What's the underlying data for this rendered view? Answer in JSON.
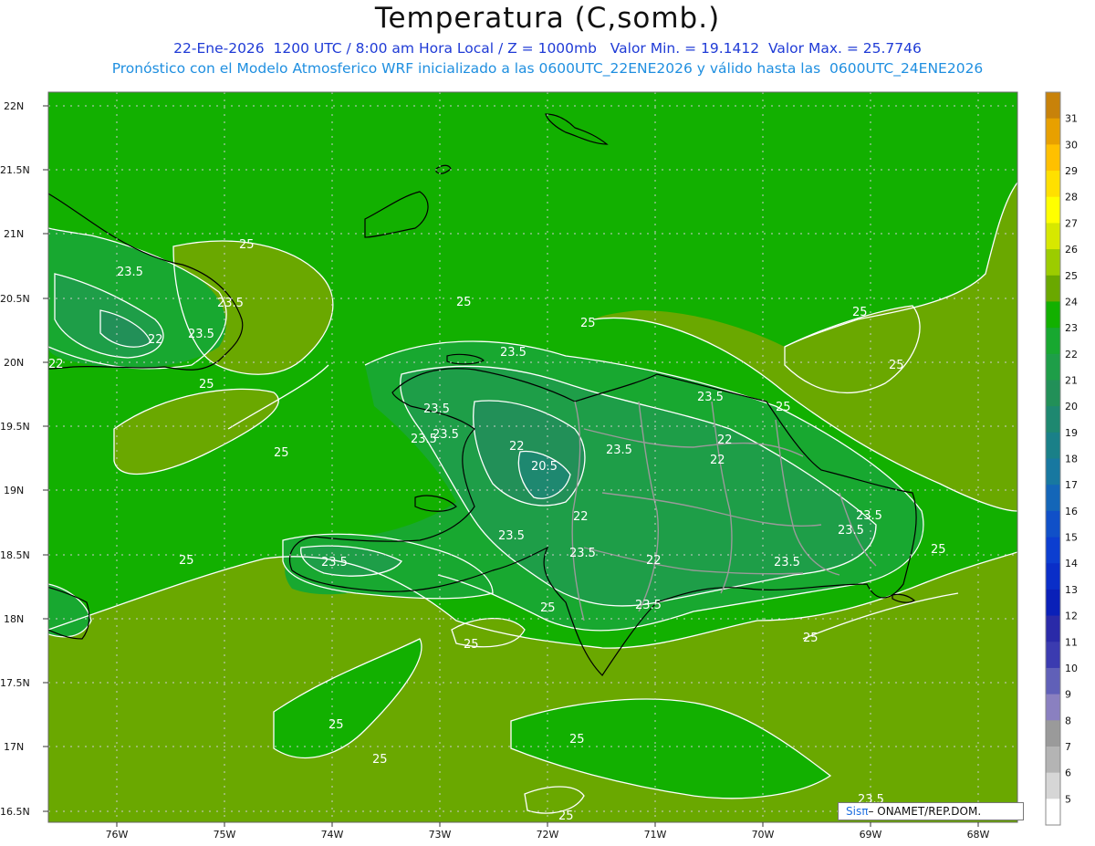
{
  "header": {
    "title": "Temperatura (C,somb.)",
    "line1": "22-Ene-2026  1200 UTC / 8:00 am Hora Local / Z = 1000mb   Valor Min. = 19.1412  Valor Max. = 25.7746",
    "line2": "Pronóstico con el Modelo Atmosferico WRF inicializado a las 0600UTC_22ENE2026 y válido hasta las  0600UTC_24ENE2026"
  },
  "axes": {
    "lat_labels": [
      "22N",
      "21.5N",
      "21N",
      "20.5N",
      "20N",
      "19.5N",
      "19N",
      "18.5N",
      "18N",
      "17.5N",
      "17N",
      "16.5N"
    ],
    "lon_labels": [
      "76W",
      "75W",
      "74W",
      "73W",
      "72W",
      "71W",
      "70W",
      "69W",
      "68W"
    ]
  },
  "colorbar": {
    "labels": [
      "31",
      "30",
      "29",
      "28",
      "27",
      "26",
      "25",
      "24",
      "23",
      "22",
      "21",
      "20",
      "19",
      "18",
      "17",
      "16",
      "15",
      "14",
      "13",
      "12",
      "11",
      "10",
      "9",
      "8",
      "7",
      "6",
      "5"
    ],
    "colors": [
      "#c8820a",
      "#e8a000",
      "#ffc000",
      "#ffe000",
      "#ffff00",
      "#d7e800",
      "#9ccc00",
      "#6aa800",
      "#12b000",
      "#18a830",
      "#1e9e48",
      "#229058",
      "#1e8870",
      "#1a8088",
      "#1878a0",
      "#1466b8",
      "#1050c8",
      "#0c3ed0",
      "#0a2ec8",
      "#0a20b8",
      "#2a2aa8",
      "#3b3bb0",
      "#6060b8",
      "#8a80c0",
      "#9a9a9a",
      "#b4b4b4",
      "#d6d6d6",
      "#ffffff"
    ]
  },
  "contour_labels": [
    {
      "text": "25"
    },
    {
      "text": "23.5"
    },
    {
      "text": "23.5"
    },
    {
      "text": "22"
    },
    {
      "text": "23.5"
    },
    {
      "text": "22"
    },
    {
      "text": "25"
    },
    {
      "text": "25"
    },
    {
      "text": "25"
    },
    {
      "text": "25"
    },
    {
      "text": "25"
    },
    {
      "text": "25"
    },
    {
      "text": "23.5"
    },
    {
      "text": "23.5"
    },
    {
      "text": "23.5"
    },
    {
      "text": "22"
    },
    {
      "text": "20.5"
    },
    {
      "text": "22"
    },
    {
      "text": "23.5"
    },
    {
      "text": "23.5"
    },
    {
      "text": "22"
    },
    {
      "text": "22"
    },
    {
      "text": "23.5"
    },
    {
      "text": "23.5"
    },
    {
      "text": "23.5"
    },
    {
      "text": "25"
    },
    {
      "text": "22"
    },
    {
      "text": "23.5"
    },
    {
      "text": "23.5"
    },
    {
      "text": "23.5"
    },
    {
      "text": "25"
    },
    {
      "text": "25"
    },
    {
      "text": "25"
    },
    {
      "text": "23.5"
    },
    {
      "text": "23.5"
    },
    {
      "text": "25"
    },
    {
      "text": "25"
    },
    {
      "text": "25"
    },
    {
      "text": "25"
    },
    {
      "text": "25"
    },
    {
      "text": "25"
    },
    {
      "text": "23.5"
    }
  ],
  "credit": {
    "logo": "Sisπ",
    "text": "– ONAMET/REP.DOM."
  }
}
